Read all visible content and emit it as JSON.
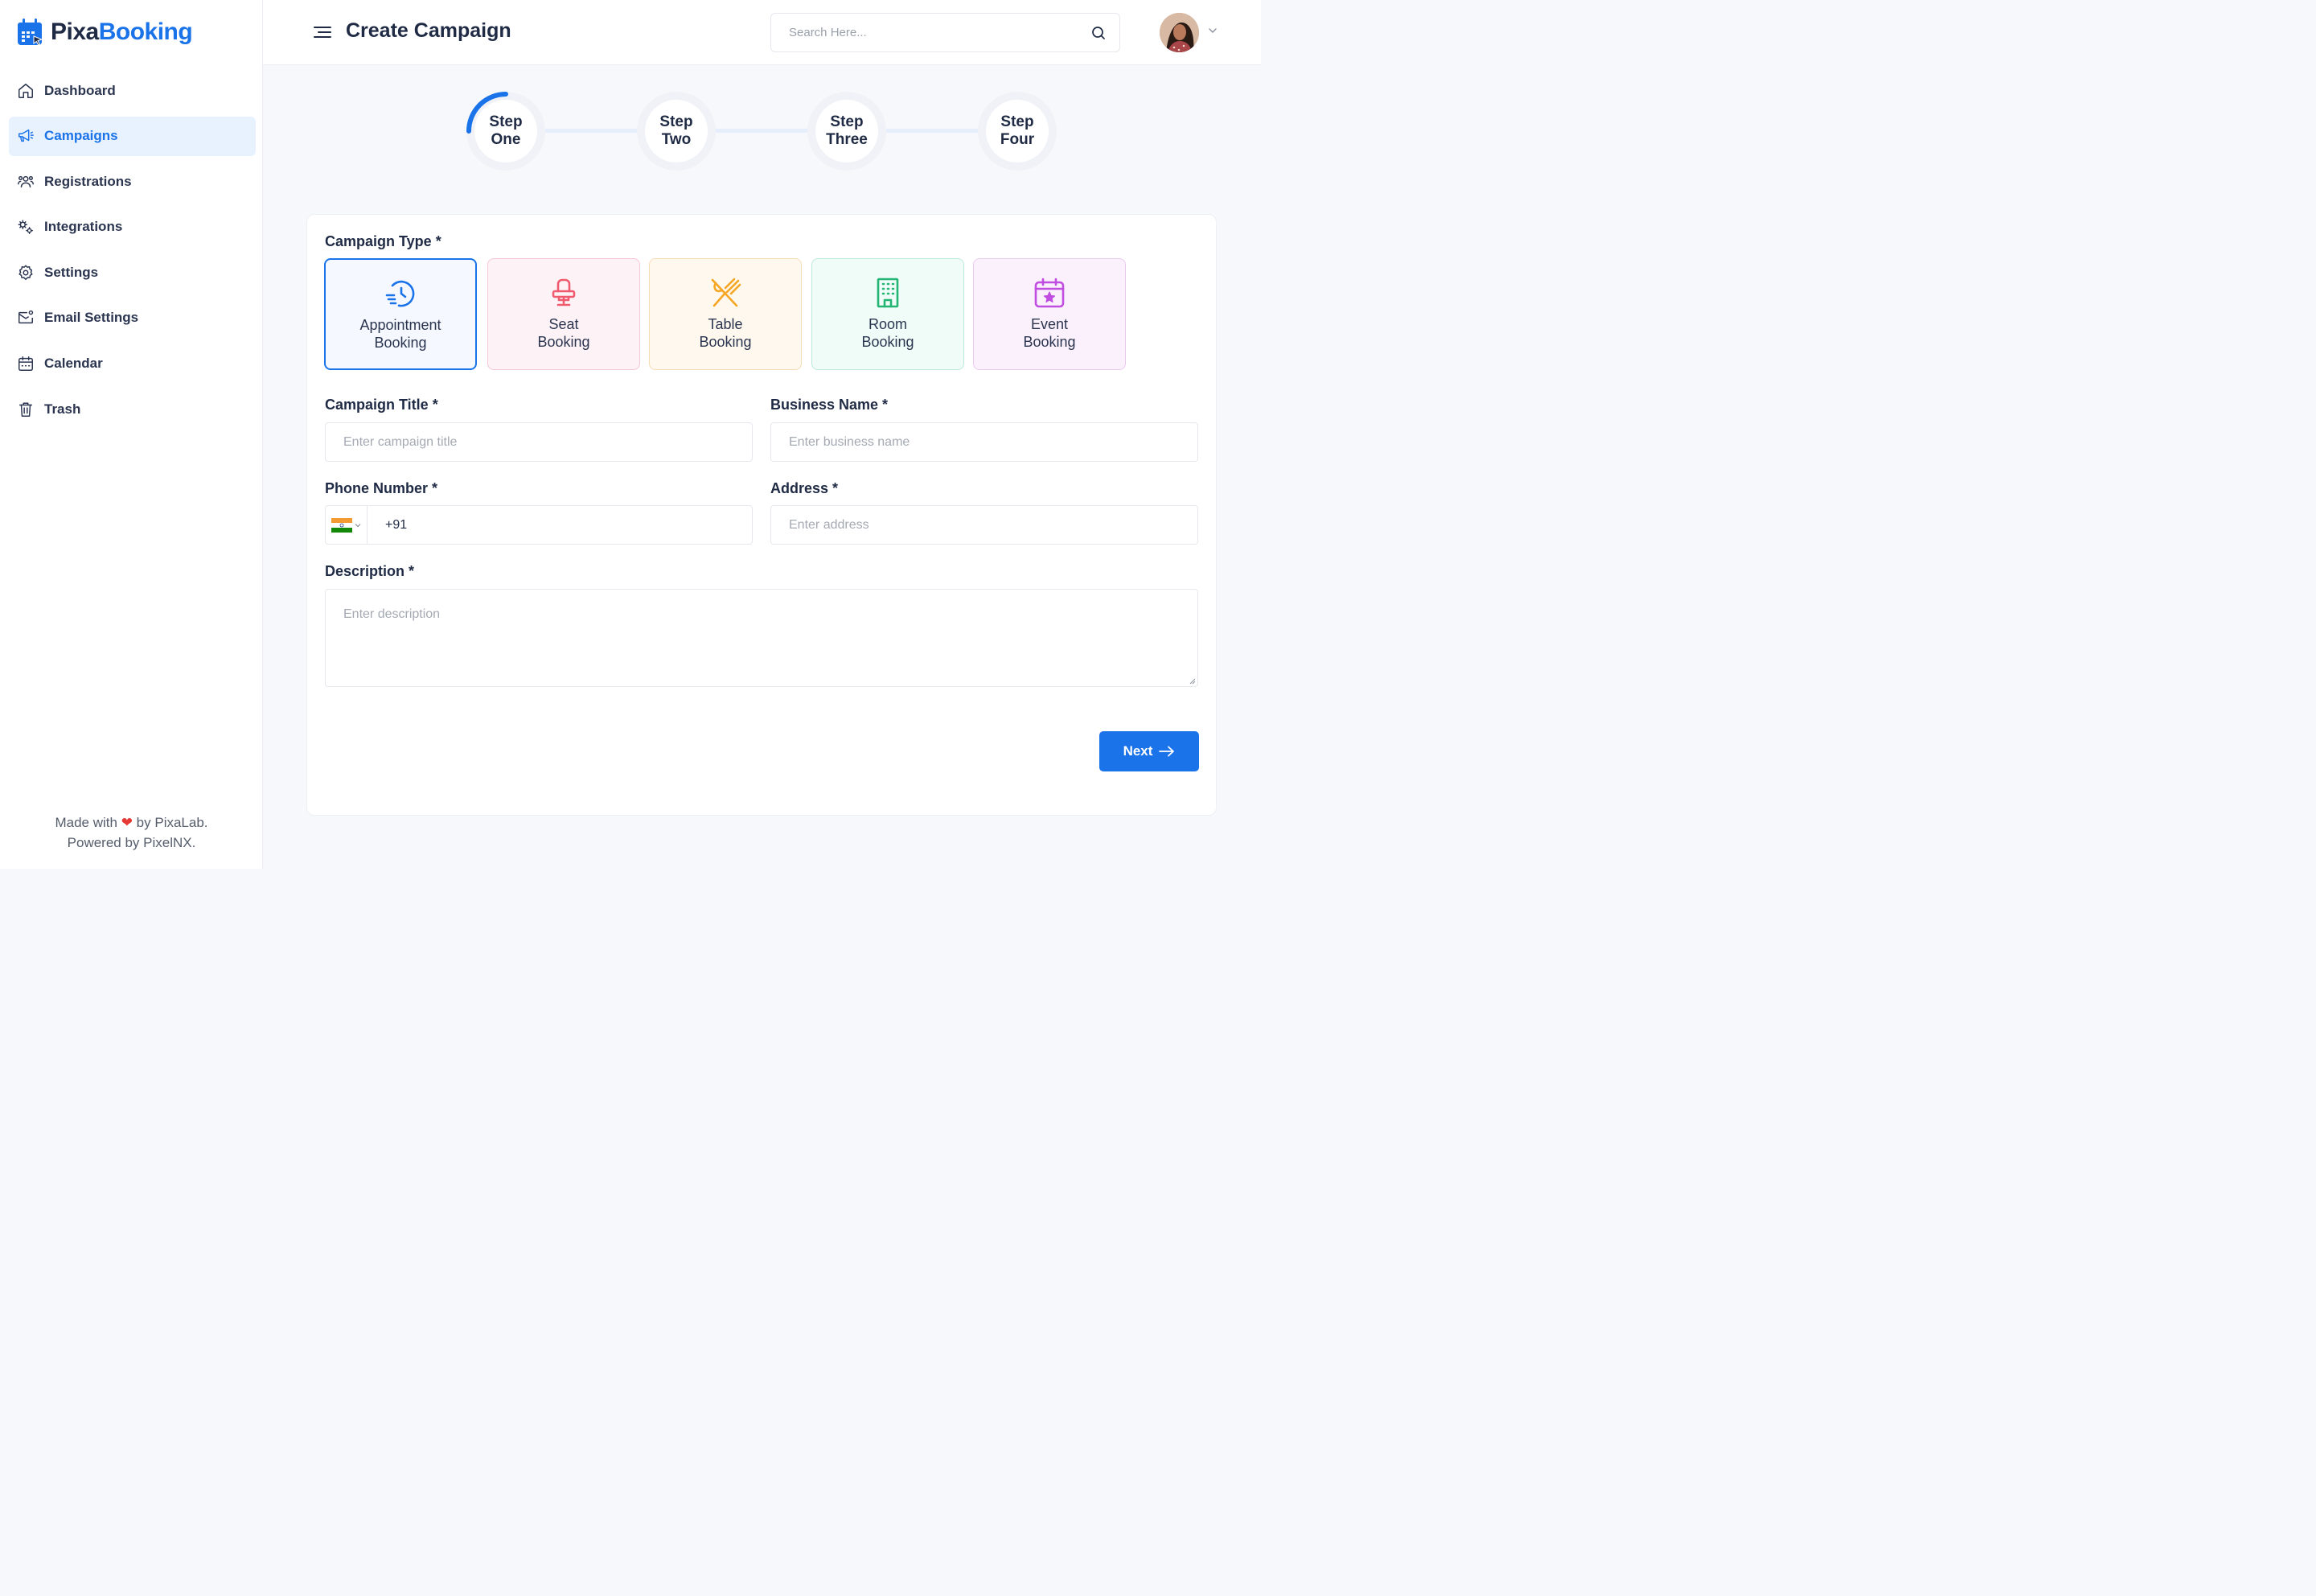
{
  "brand": {
    "part1": "Pixa",
    "part2": "Booking"
  },
  "sidebar": {
    "items": [
      {
        "label": "Dashboard",
        "icon": "home-icon"
      },
      {
        "label": "Campaigns",
        "icon": "megaphone-icon",
        "active": true
      },
      {
        "label": "Registrations",
        "icon": "users-icon"
      },
      {
        "label": "Integrations",
        "icon": "integrations-icon"
      },
      {
        "label": "Settings",
        "icon": "gear-icon"
      },
      {
        "label": "Email Settings",
        "icon": "email-settings-icon"
      },
      {
        "label": "Calendar",
        "icon": "calendar-icon"
      },
      {
        "label": "Trash",
        "icon": "trash-icon"
      }
    ],
    "footer": {
      "made_with": "Made with",
      "heart": "❤",
      "by": "by PixaLab.",
      "powered": "Powered by PixelNX."
    }
  },
  "header": {
    "title": "Create Campaign",
    "search_placeholder": "Search Here..."
  },
  "stepper": {
    "progress": 0.25,
    "steps": [
      {
        "line1": "Step",
        "line2": "One"
      },
      {
        "line1": "Step",
        "line2": "Two"
      },
      {
        "line1": "Step",
        "line2": "Three"
      },
      {
        "line1": "Step",
        "line2": "Four"
      }
    ]
  },
  "form": {
    "campaign_type_label": "Campaign Type *",
    "types": [
      {
        "line1": "Appointment",
        "line2": "Booking",
        "icon": "clock-icon",
        "color": "#1a73e8"
      },
      {
        "line1": "Seat",
        "line2": "Booking",
        "icon": "chair-icon",
        "color": "#ef5a6f"
      },
      {
        "line1": "Table",
        "line2": "Booking",
        "icon": "utensils-icon",
        "color": "#f5a623"
      },
      {
        "line1": "Room",
        "line2": "Booking",
        "icon": "building-icon",
        "color": "#22b573"
      },
      {
        "line1": "Event",
        "line2": "Booking",
        "icon": "calendar-star-icon",
        "color": "#c04ee0"
      }
    ],
    "campaign_title": {
      "label": "Campaign Title *",
      "placeholder": "Enter campaign title"
    },
    "business_name": {
      "label": "Business Name *",
      "placeholder": "Enter business name"
    },
    "phone": {
      "label": "Phone Number *",
      "value": "+91"
    },
    "address": {
      "label": "Address *",
      "placeholder": "Enter address"
    },
    "description": {
      "label": "Description *",
      "placeholder": "Enter description"
    },
    "next_label": "Next"
  },
  "colors": {
    "accent": "#1a73e8",
    "text": "#1f2a44"
  }
}
